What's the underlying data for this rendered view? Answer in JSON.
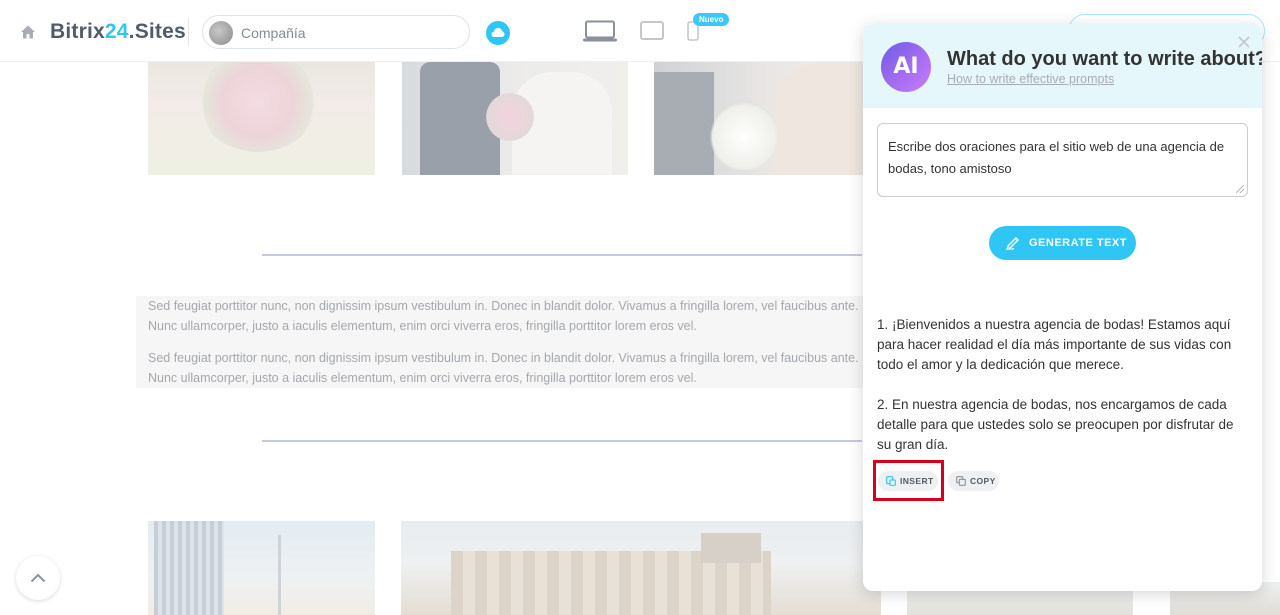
{
  "topbar": {
    "brand_part1": "Bitrix",
    "brand_part2": "24",
    "brand_part3": ".Sites",
    "site_name": "Compañía",
    "new_badge": "Nuevo"
  },
  "preview": {
    "paragraph_1": "Sed feugiat porttitor nunc, non dignissim ipsum vestibulum in. Donec in blandit dolor. Vivamus a fringilla lorem, vel faucibus ante. Nunc ullamcorper, justo a iaculis elementum, enim orci viverra eros, fringilla porttitor lorem eros vel.",
    "paragraph_2": "Sed feugiat porttitor nunc, non dignissim ipsum vestibulum in. Donec in blandit dolor. Vivamus a fringilla lorem, vel faucibus ante. Nunc ullamcorper, justo a iaculis elementum, enim orci viverra eros, fringilla porttitor lorem eros vel."
  },
  "ai_panel": {
    "logo_text": "AI",
    "title": "What do you want to write about?",
    "help_link": "How to write effective prompts",
    "prompt": "Escribe dos oraciones para el sitio web de una agencia de bodas, tono amistoso",
    "generate_label": "GENERATE TEXT",
    "result_1": "1. ¡Bienvenidos a nuestra agencia de bodas! Estamos aquí para hacer realidad el día más importante de sus vidas con todo el amor y la dedicación que merece.",
    "result_2": "2. En nuestra agencia de bodas, nos encargamos de cada detalle para que ustedes solo se preocupen por disfrutar de su gran día.",
    "insert_label": "INSERT",
    "copy_label": "COPY"
  },
  "colors": {
    "accent": "#2fc6f6",
    "highlight": "#d6001c",
    "header_bg": "#e5f7fa"
  }
}
